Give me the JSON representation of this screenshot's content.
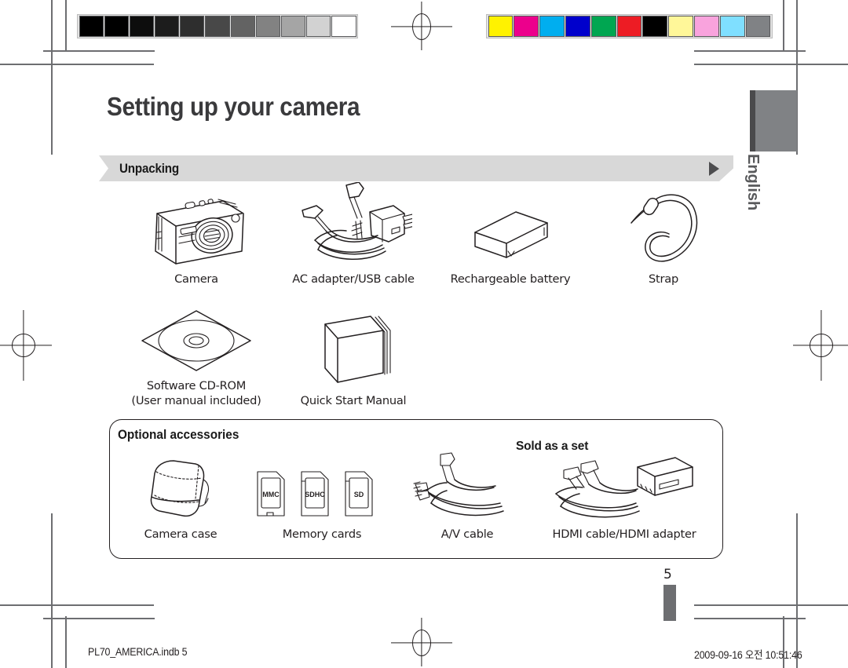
{
  "document": {
    "headline": "Setting up your camera",
    "language_tab": "English",
    "page_number": "5"
  },
  "banner": {
    "label": "Unpacking",
    "arrow_icon": "triangle-right-icon",
    "background_color": "#d8d8d8"
  },
  "calibration": {
    "grayscale_bar": {
      "swatches": [
        "#000000",
        "#000000",
        "#0d0d0d",
        "#1c1c1c",
        "#2e2e2e",
        "#484848",
        "#636363",
        "#828282",
        "#a5a5a5",
        "#d2d2d2",
        "#ffffff"
      ]
    },
    "color_bar": {
      "swatches": [
        "#fff200",
        "#ec008c",
        "#00aeef",
        "#0000cc",
        "#00a651",
        "#ed1c24",
        "#000000",
        "#fff799",
        "#f9a3dd",
        "#7fdfff",
        "#808285"
      ],
      "names": [
        "yellow",
        "magenta",
        "cyan",
        "blue",
        "green",
        "red",
        "black",
        "light-yellow",
        "light-magenta",
        "light-cyan",
        "gray"
      ]
    }
  },
  "unpacking_items": [
    {
      "caption": "Camera",
      "icon": "camera-icon"
    },
    {
      "caption": "AC adapter/USB cable",
      "icon": "ac-adapter-usb-cable-icon"
    },
    {
      "caption": "Rechargeable battery",
      "icon": "battery-icon"
    },
    {
      "caption": "Strap",
      "icon": "strap-icon"
    },
    {
      "caption": "Software CD-ROM\n(User manual included)",
      "icon": "cd-rom-icon"
    },
    {
      "caption": "Quick Start Manual",
      "icon": "manual-booklet-icon"
    }
  ],
  "optional_accessories": {
    "title": "Optional accessories",
    "sold_as_a_set_note": "Sold as a set",
    "items": [
      {
        "caption": "Camera case",
        "icon": "camera-case-icon"
      },
      {
        "caption": "Memory cards",
        "icon": "memory-cards-icon",
        "card_labels": [
          "MMC",
          "SDHC",
          "SD"
        ]
      },
      {
        "caption": "A/V cable",
        "icon": "av-cable-icon"
      },
      {
        "caption": "HDMI cable/HDMI adapter",
        "icon": "hdmi-cable-adapter-icon"
      }
    ]
  },
  "footer": {
    "file_name": "PL70_AMERICA.indb   5",
    "timestamp": "2009-09-16   오전 10:51:46"
  }
}
